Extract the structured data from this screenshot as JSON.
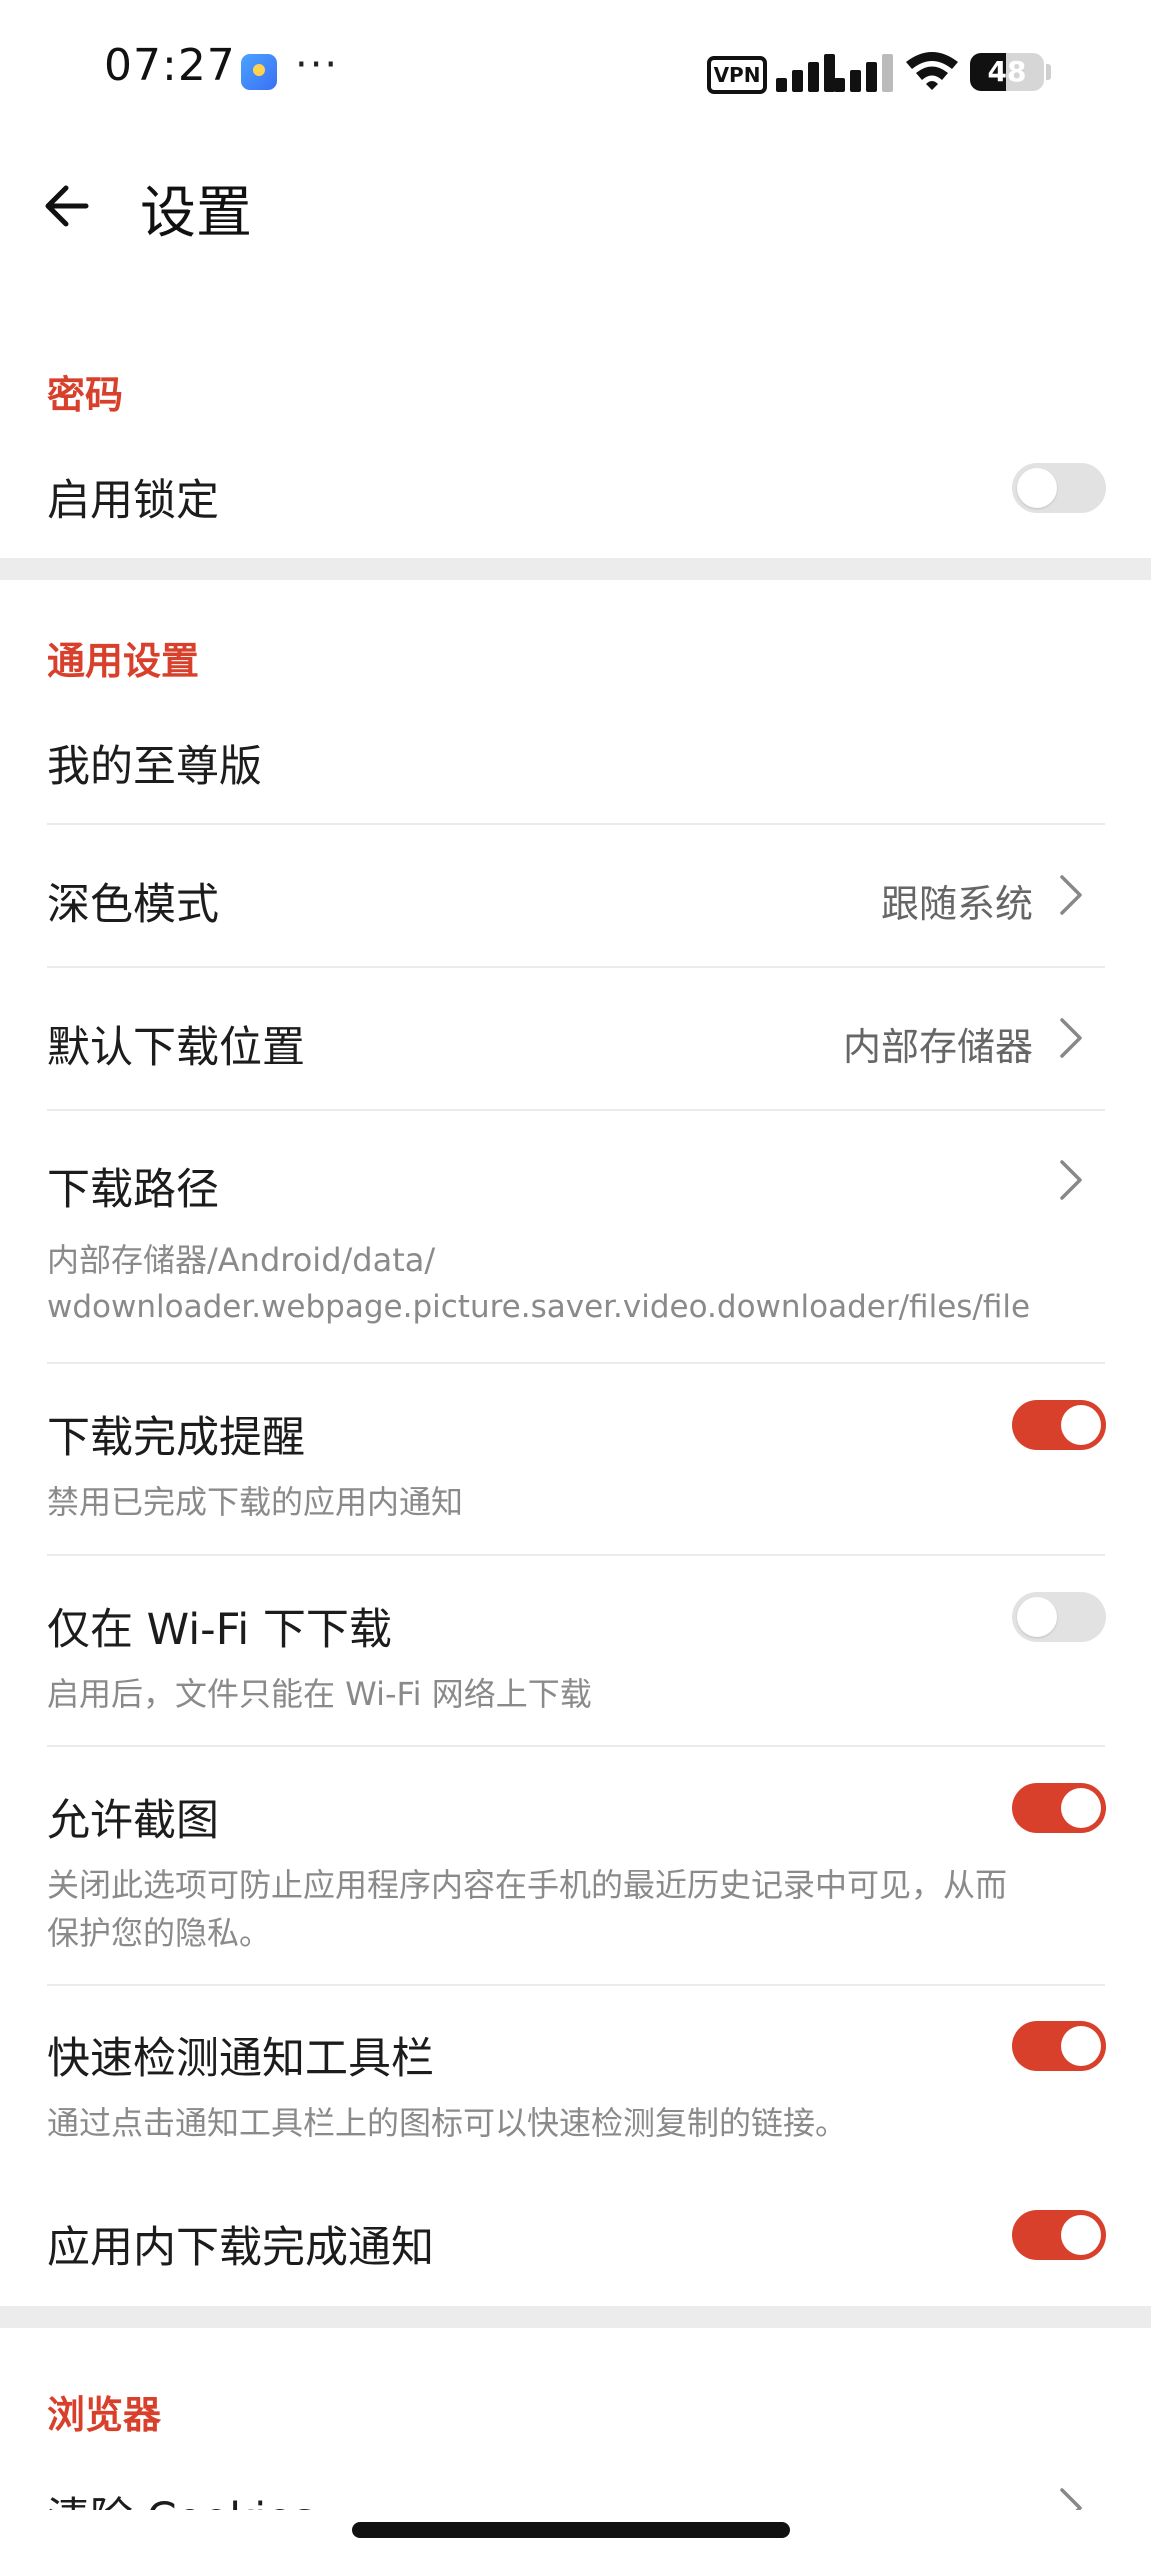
{
  "status_bar": {
    "time": "07:27",
    "more": "···",
    "vpn_label": "VPN",
    "battery_level": "48",
    "icons": [
      "photos-app-icon",
      "vpn-icon",
      "signal-icon",
      "wifi-icon",
      "battery-icon"
    ]
  },
  "header": {
    "title": "设置",
    "back_icon": "arrow-left-icon"
  },
  "sections": {
    "password": {
      "header": "密码",
      "enable_lock": {
        "title": "启用锁定",
        "toggle": "off"
      }
    },
    "general": {
      "header": "通用设置",
      "premium": {
        "title": "我的至尊版"
      },
      "dark_mode": {
        "title": "深色模式",
        "value": "跟随系统"
      },
      "download_location": {
        "title": "默认下载位置",
        "value": "内部存储器"
      },
      "download_path": {
        "title": "下载路径",
        "desc_line1": "内部存储器/Android/data/",
        "desc_line2": "wdownloader.webpage.picture.saver.video.downloader/files/file"
      },
      "download_complete_reminder": {
        "title": "下载完成提醒",
        "desc": "禁用已完成下载的应用内通知",
        "toggle": "on"
      },
      "wifi_only": {
        "title": "仅在 Wi-Fi 下下载",
        "desc": "启用后，文件只能在 Wi-Fi 网络上下载",
        "toggle": "off"
      },
      "allow_screenshot": {
        "title": "允许截图",
        "desc_line1": "关闭此选项可防止应用程序内容在手机的最近历史记录中可见，从而",
        "desc_line2": "保护您的隐私。",
        "toggle": "on"
      },
      "quick_detect_toolbar": {
        "title": "快速检测通知工具栏",
        "desc": "通过点击通知工具栏上的图标可以快速检测复制的链接。",
        "toggle": "on"
      },
      "in_app_download_notification": {
        "title": "应用内下载完成通知",
        "toggle": "on"
      }
    },
    "browser": {
      "header": "浏览器",
      "clear_cookies": {
        "title": "清除 Cookies"
      }
    }
  },
  "colors": {
    "accent": "#d8402c",
    "toggle_off": "#e2e2e2",
    "section_band": "#ececec"
  }
}
